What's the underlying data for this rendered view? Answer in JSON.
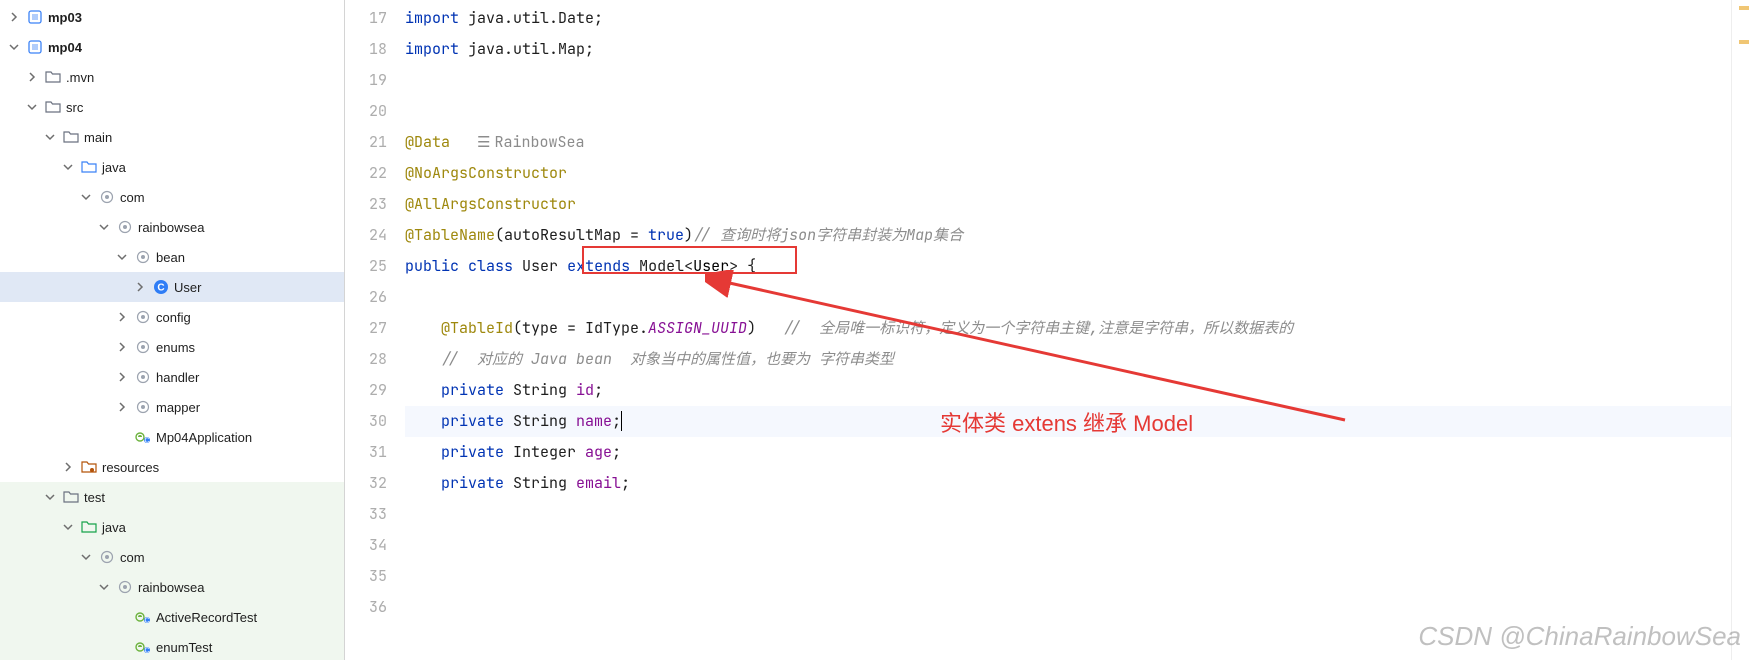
{
  "sidebar": {
    "items": [
      {
        "indent": 0,
        "chev": "right",
        "icon": "module",
        "label": "mp03",
        "bold": true
      },
      {
        "indent": 0,
        "chev": "down",
        "icon": "module",
        "label": "mp04",
        "bold": true
      },
      {
        "indent": 1,
        "chev": "right",
        "icon": "folder",
        "label": ".mvn"
      },
      {
        "indent": 1,
        "chev": "down",
        "icon": "folder",
        "label": "src"
      },
      {
        "indent": 2,
        "chev": "down",
        "icon": "folder",
        "label": "main"
      },
      {
        "indent": 3,
        "chev": "down",
        "icon": "folder-src",
        "label": "java"
      },
      {
        "indent": 4,
        "chev": "down",
        "icon": "package",
        "label": "com"
      },
      {
        "indent": 5,
        "chev": "down",
        "icon": "package",
        "label": "rainbowsea"
      },
      {
        "indent": 6,
        "chev": "down",
        "icon": "package",
        "label": "bean"
      },
      {
        "indent": 7,
        "chev": "right",
        "icon": "class",
        "label": "User",
        "selected": true
      },
      {
        "indent": 6,
        "chev": "right",
        "icon": "package",
        "label": "config"
      },
      {
        "indent": 6,
        "chev": "right",
        "icon": "package",
        "label": "enums"
      },
      {
        "indent": 6,
        "chev": "right",
        "icon": "package",
        "label": "handler"
      },
      {
        "indent": 6,
        "chev": "right",
        "icon": "package",
        "label": "mapper"
      },
      {
        "indent": 6,
        "chev": "blank",
        "icon": "spring",
        "label": "Mp04Application"
      },
      {
        "indent": 3,
        "chev": "right",
        "icon": "folder-res",
        "label": "resources"
      },
      {
        "indent": 2,
        "chev": "down",
        "icon": "folder",
        "label": "test",
        "testzone": true
      },
      {
        "indent": 3,
        "chev": "down",
        "icon": "folder-test",
        "label": "java",
        "testzone": true
      },
      {
        "indent": 4,
        "chev": "down",
        "icon": "package",
        "label": "com",
        "testzone": true
      },
      {
        "indent": 5,
        "chev": "down",
        "icon": "package",
        "label": "rainbowsea",
        "testzone": true
      },
      {
        "indent": 6,
        "chev": "blank",
        "icon": "spring",
        "label": "ActiveRecordTest",
        "testzone": true
      },
      {
        "indent": 6,
        "chev": "blank",
        "icon": "spring",
        "label": "enumTest",
        "testzone": true
      }
    ]
  },
  "editor": {
    "first_line": 17,
    "lines": [
      {
        "n": 17,
        "t": "import",
        "rest": " java.util.Date;"
      },
      {
        "n": 18,
        "t": "import",
        "rest": " java.util.Map;"
      },
      {
        "n": 19,
        "blank": true
      },
      {
        "n": 20,
        "blank": true
      },
      {
        "n": 21,
        "ann": "@Data",
        "author": "RainbowSea"
      },
      {
        "n": 22,
        "ann": "@NoArgsConstructor"
      },
      {
        "n": 23,
        "ann": "@AllArgsConstructor"
      },
      {
        "n": 24,
        "tablename": {
          "ann": "@TableName",
          "arg": "autoResultMap = ",
          "val": "true",
          "cmt": "// 查询时将json字符串封装为Map集合"
        }
      },
      {
        "n": 25,
        "classdef": true
      },
      {
        "n": 26,
        "blank": true
      },
      {
        "n": 27,
        "tableid": {
          "ann": "@TableId",
          "arg": "type = IdType.",
          "enum": "ASSIGN_UUID",
          "cmt": "//  全局唯一标识符，定义为一个字符串主键,注意是字符串，所以数据表的"
        }
      },
      {
        "n": 28,
        "cmtline": "//  对应的 Java bean  对象当中的属性值，也要为 字符串类型"
      },
      {
        "n": 29,
        "field": {
          "type": "String",
          "name": "id"
        }
      },
      {
        "n": 30,
        "field": {
          "type": "String",
          "name": "name"
        },
        "hl": true,
        "cursor": true
      },
      {
        "n": 31,
        "field": {
          "type": "Integer",
          "name": "age"
        }
      },
      {
        "n": 32,
        "field": {
          "type": "String",
          "name": "email"
        }
      },
      {
        "n": 33,
        "blank": true
      },
      {
        "n": 34,
        "blank": true
      },
      {
        "n": 35,
        "blank": true
      },
      {
        "n": 36,
        "blank": true
      }
    ],
    "class_tokens": {
      "public": "public",
      "class": "class",
      "name": "User",
      "extends": "extends",
      "model": "Model",
      "generic": "User"
    }
  },
  "annotation_text": "实体类 extens 继承 Model",
  "watermark": "CSDN @ChinaRainbowSea"
}
